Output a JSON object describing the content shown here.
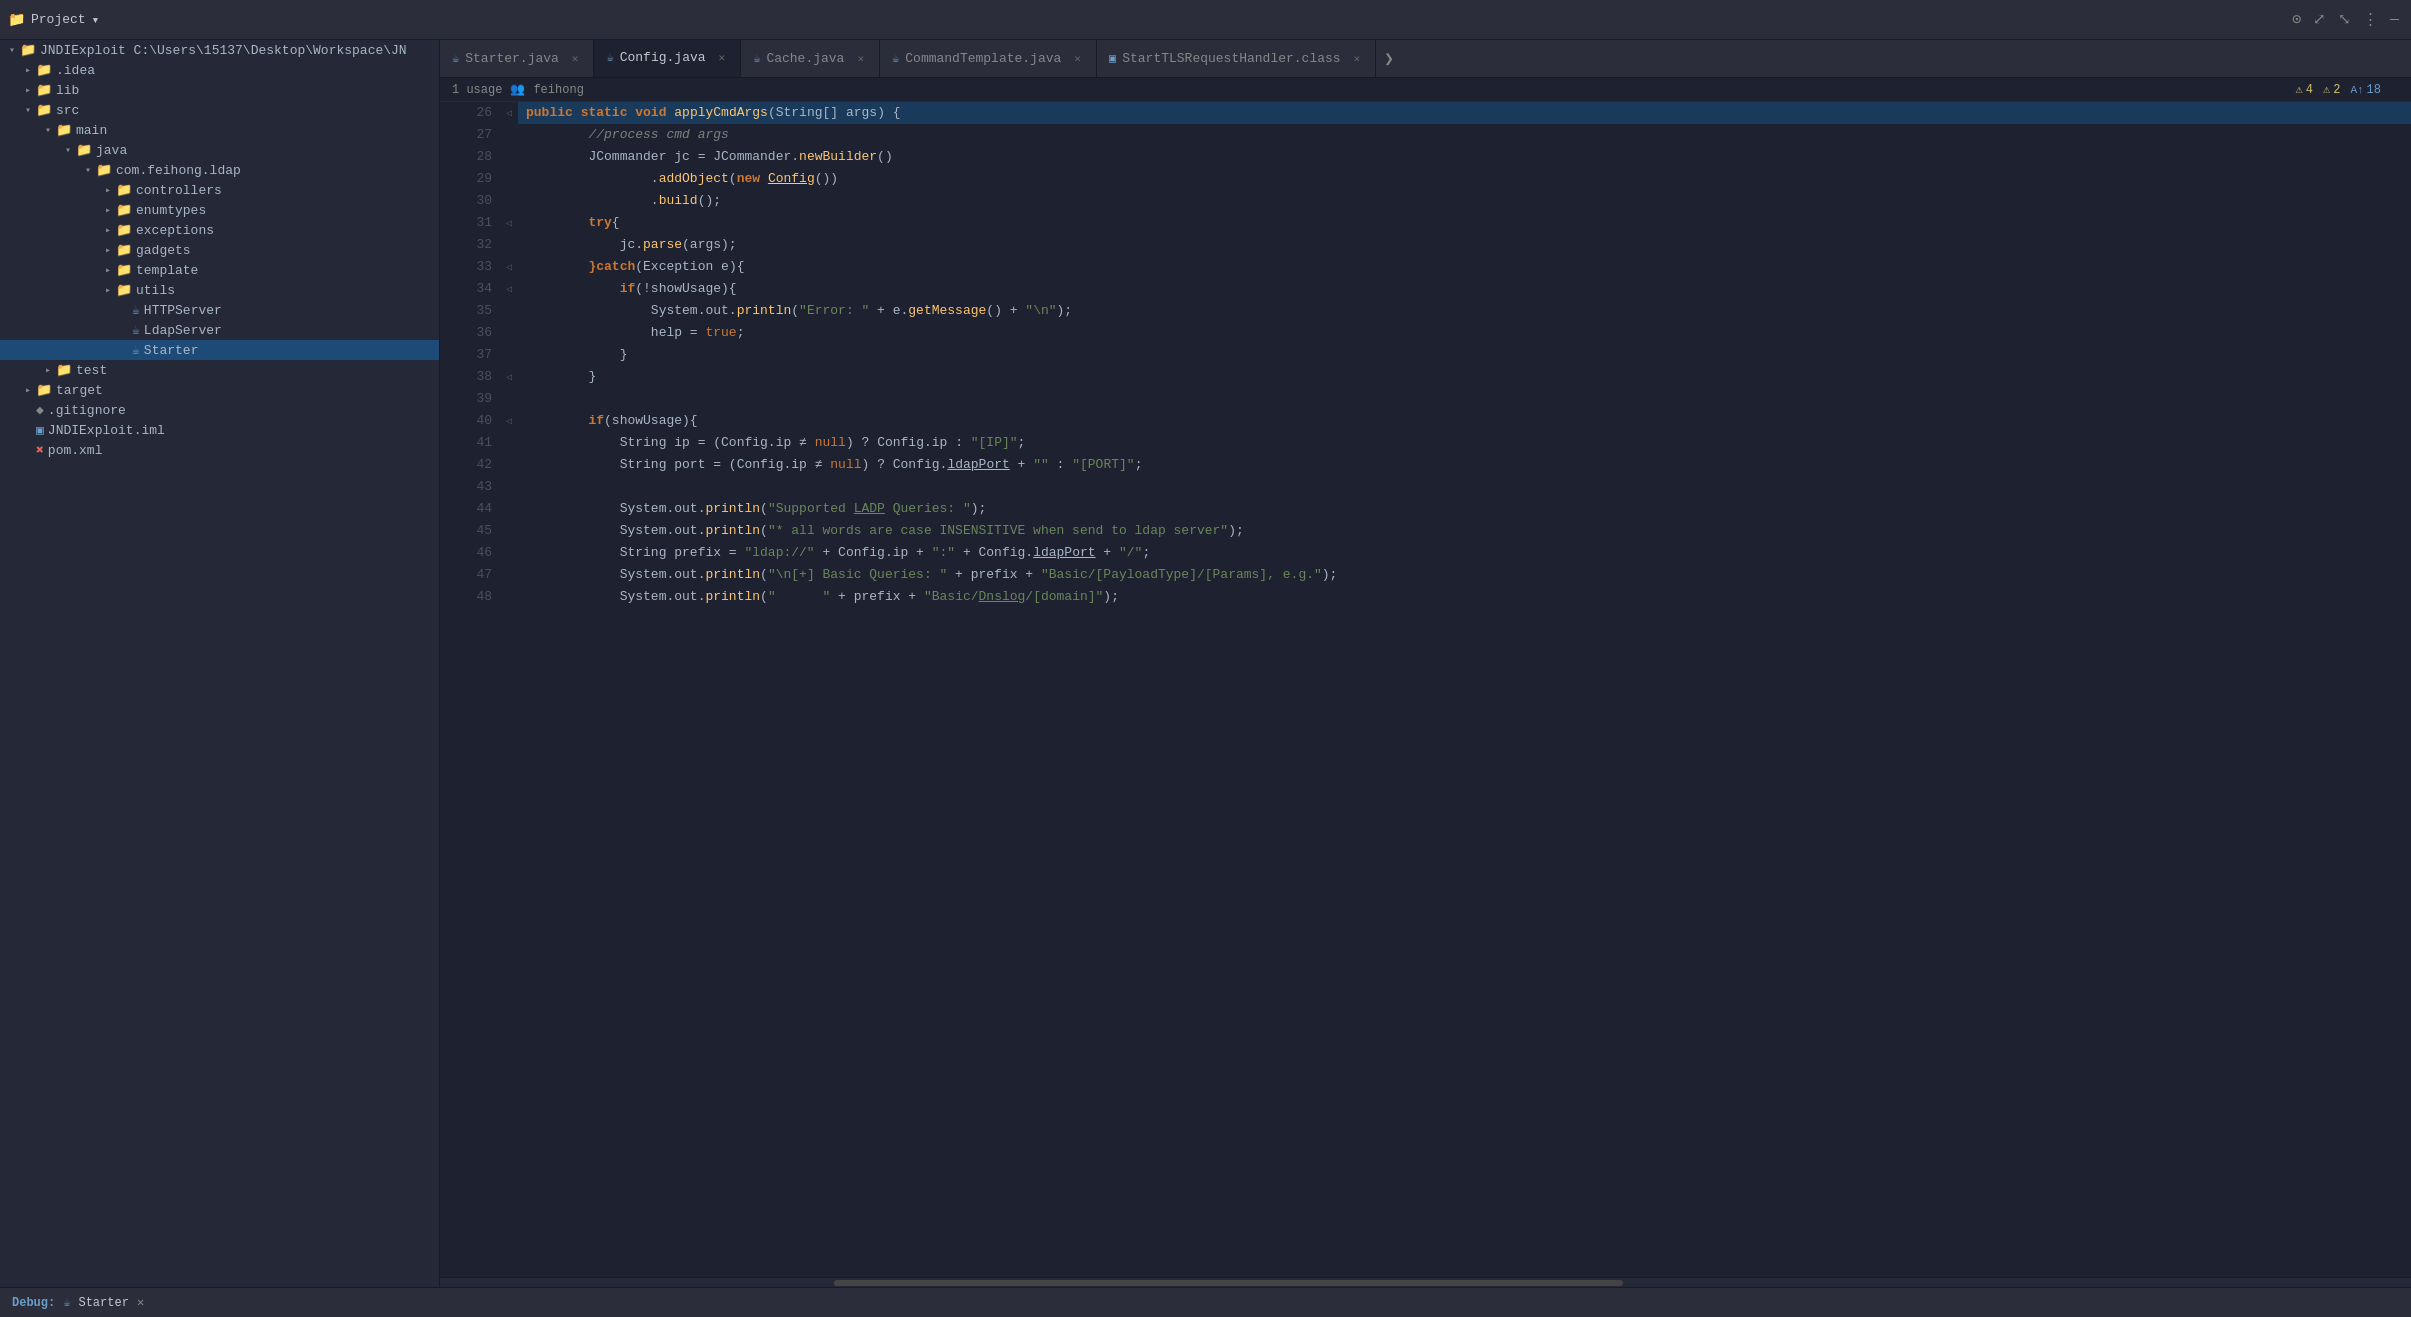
{
  "topbar": {
    "project_label": "Project",
    "project_name": "JNDIExploit",
    "project_path": "C:\\Users\\15137\\Desktop\\Workspace\\JN",
    "chevron": "▾",
    "icons": {
      "target": "⊙",
      "expand": "⤢",
      "collapse": "⤡",
      "menu": "⋮",
      "minimize": "—"
    }
  },
  "sidebar": {
    "items": [
      {
        "id": "JNDIExploit",
        "label": "JNDIExploit C:\\Users\\15137\\Desktop\\Workspace\\JN",
        "indent": 0,
        "arrow": "▾",
        "icon": "📁",
        "icon_class": "icon-folder-blue",
        "selected": false
      },
      {
        "id": ".idea",
        "label": ".idea",
        "indent": 1,
        "arrow": "▸",
        "icon": "📁",
        "icon_class": "icon-folder-blue",
        "selected": false
      },
      {
        "id": "lib",
        "label": "lib",
        "indent": 1,
        "arrow": "▸",
        "icon": "📁",
        "icon_class": "icon-folder-green",
        "selected": false
      },
      {
        "id": "src",
        "label": "src",
        "indent": 1,
        "arrow": "▾",
        "icon": "📁",
        "icon_class": "icon-folder-src",
        "selected": false
      },
      {
        "id": "main",
        "label": "main",
        "indent": 2,
        "arrow": "▾",
        "icon": "📁",
        "icon_class": "icon-folder-blue",
        "selected": false
      },
      {
        "id": "java",
        "label": "java",
        "indent": 3,
        "arrow": "▾",
        "icon": "📁",
        "icon_class": "icon-folder-java",
        "selected": false
      },
      {
        "id": "com.feihong.ldap",
        "label": "com.feihong.ldap",
        "indent": 4,
        "arrow": "▾",
        "icon": "📁",
        "icon_class": "icon-folder-blue",
        "selected": false
      },
      {
        "id": "controllers",
        "label": "controllers",
        "indent": 5,
        "arrow": "▸",
        "icon": "📁",
        "icon_class": "icon-folder-ctrl",
        "selected": false
      },
      {
        "id": "enumtypes",
        "label": "enumtypes",
        "indent": 5,
        "arrow": "▸",
        "icon": "📁",
        "icon_class": "icon-folder-enum",
        "selected": false
      },
      {
        "id": "exceptions",
        "label": "exceptions",
        "indent": 5,
        "arrow": "▸",
        "icon": "📁",
        "icon_class": "icon-folder-exc",
        "selected": false
      },
      {
        "id": "gadgets",
        "label": "gadgets",
        "indent": 5,
        "arrow": "▸",
        "icon": "📁",
        "icon_class": "icon-folder-gadgets",
        "selected": false
      },
      {
        "id": "template",
        "label": "template",
        "indent": 5,
        "arrow": "▸",
        "icon": "📁",
        "icon_class": "icon-folder-template",
        "selected": false
      },
      {
        "id": "utils",
        "label": "utils",
        "indent": 5,
        "arrow": "▸",
        "icon": "📁",
        "icon_class": "icon-folder-utils",
        "selected": false
      },
      {
        "id": "HTTPServer",
        "label": "HTTPServer",
        "indent": 5,
        "arrow": "",
        "icon": "☕",
        "icon_class": "icon-java",
        "selected": false
      },
      {
        "id": "LdapServer",
        "label": "LdapServer",
        "indent": 5,
        "arrow": "",
        "icon": "☕",
        "icon_class": "icon-java",
        "selected": false
      },
      {
        "id": "Starter",
        "label": "Starter",
        "indent": 5,
        "arrow": "",
        "icon": "☕",
        "icon_class": "icon-java",
        "selected": true
      },
      {
        "id": "test",
        "label": "test",
        "indent": 2,
        "arrow": "▸",
        "icon": "📁",
        "icon_class": "icon-folder-green",
        "selected": false
      },
      {
        "id": "target",
        "label": "target",
        "indent": 1,
        "arrow": "▸",
        "icon": "📁",
        "icon_class": "icon-folder-blue",
        "selected": false
      },
      {
        "id": ".gitignore",
        "label": ".gitignore",
        "indent": 1,
        "arrow": "",
        "icon": "◆",
        "icon_class": "icon-gitignore",
        "selected": false
      },
      {
        "id": "JNDIExploit.iml",
        "label": "JNDIExploit.iml",
        "indent": 1,
        "arrow": "",
        "icon": "▣",
        "icon_class": "icon-iml",
        "selected": false
      },
      {
        "id": "pom.xml",
        "label": "pom.xml",
        "indent": 1,
        "arrow": "",
        "icon": "✖",
        "icon_class": "icon-xml",
        "selected": false
      }
    ]
  },
  "tabs": [
    {
      "id": "starter",
      "label": "Starter.java",
      "icon": "☕",
      "icon_color": "#6b9eca",
      "active": false,
      "closeable": true
    },
    {
      "id": "config",
      "label": "Config.java",
      "icon": "☕",
      "icon_color": "#6b9eca",
      "active": true,
      "closeable": true
    },
    {
      "id": "cache",
      "label": "Cache.java",
      "icon": "☕",
      "icon_color": "#6b9eca",
      "active": false,
      "closeable": true
    },
    {
      "id": "commandtemplate",
      "label": "CommandTemplate.java",
      "icon": "☕",
      "icon_color": "#6b9eca",
      "active": false,
      "closeable": true
    },
    {
      "id": "starttls",
      "label": "StartTLSRequestHandler.class",
      "icon": "▣",
      "icon_color": "#6b9eca",
      "active": false,
      "closeable": true
    }
  ],
  "editor": {
    "usage": "1 usage",
    "user": "feihong",
    "warnings": [
      {
        "type": "warning",
        "icon": "⚠",
        "count": "4"
      },
      {
        "type": "warning2",
        "icon": "⚠",
        "count": "2"
      },
      {
        "type": "info",
        "icon": "A↑",
        "count": "18"
      }
    ]
  },
  "code_lines": [
    {
      "num": 26,
      "fold": "◁",
      "content": "public_static_void_applyCmdArgs"
    },
    {
      "num": 27,
      "fold": "",
      "content": "comment_process_cmd_args"
    },
    {
      "num": 28,
      "fold": "",
      "content": "JCommander_jc_newBuilder"
    },
    {
      "num": 29,
      "fold": "",
      "content": "addObject_new_Config"
    },
    {
      "num": 30,
      "fold": "",
      "content": "build"
    },
    {
      "num": 31,
      "fold": "◁",
      "content": "try_open"
    },
    {
      "num": 32,
      "fold": "",
      "content": "jc_parse_args"
    },
    {
      "num": 33,
      "fold": "◁",
      "content": "catch_exception"
    },
    {
      "num": 34,
      "fold": "◁",
      "content": "if_showUsage"
    },
    {
      "num": 35,
      "fold": "",
      "content": "system_println_error"
    },
    {
      "num": 36,
      "fold": "",
      "content": "help_true"
    },
    {
      "num": 37,
      "fold": "",
      "content": "close_brace_1"
    },
    {
      "num": 38,
      "fold": "◁",
      "content": "close_brace_2"
    },
    {
      "num": 39,
      "fold": "",
      "content": "empty"
    },
    {
      "num": 40,
      "fold": "◁",
      "content": "if_showUsage_2"
    },
    {
      "num": 41,
      "fold": "",
      "content": "string_ip"
    },
    {
      "num": 42,
      "fold": "",
      "content": "string_port"
    },
    {
      "num": 43,
      "fold": "",
      "content": "empty_2"
    },
    {
      "num": 44,
      "fold": "",
      "content": "println_supported"
    },
    {
      "num": 45,
      "fold": "",
      "content": "println_all_words"
    },
    {
      "num": 46,
      "fold": "",
      "content": "string_prefix"
    },
    {
      "num": 47,
      "fold": "",
      "content": "println_basic_queries"
    },
    {
      "num": 48,
      "fold": "",
      "content": "println_basic_dnslog"
    }
  ],
  "bottom_bar": {
    "debug_label": "Debug:",
    "starter_label": "Starter",
    "close_icon": "✕"
  }
}
